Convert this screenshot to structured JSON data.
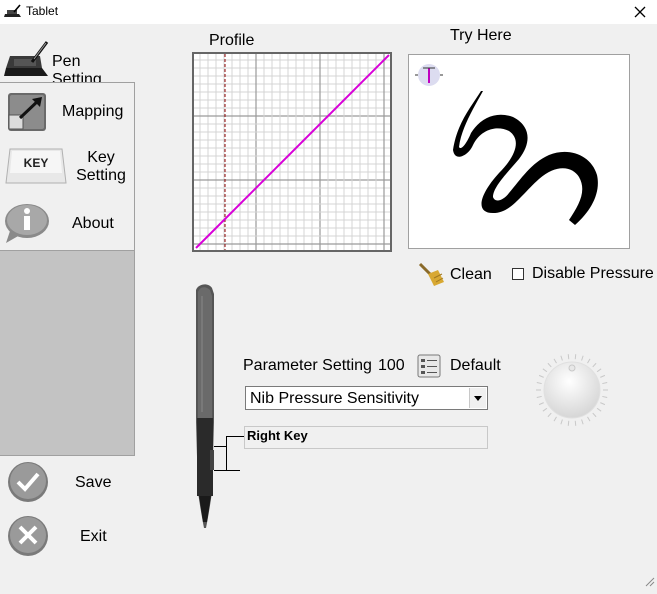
{
  "window": {
    "title": "Tablet",
    "close_icon": "close-icon"
  },
  "nav": {
    "pen_setting": "Pen Setting",
    "mapping": "Mapping",
    "key_setting_line1": "Key",
    "key_setting_line2": "Setting",
    "key_icon_text": "KEY",
    "about": "About"
  },
  "actions": {
    "save": "Save",
    "exit": "Exit"
  },
  "profile": {
    "title": "Profile",
    "line_color": "#d800d8"
  },
  "try_here": {
    "title": "Try Here"
  },
  "controls": {
    "clean": "Clean",
    "disable_pressure": "Disable Pressure",
    "disable_pressure_checked": false,
    "parameter_setting_label": "Parameter Setting",
    "parameter_value": "100",
    "default_label": "Default",
    "parameter_selected": "Nib Pressure Sensitivity",
    "right_key_value": "Right Key"
  }
}
